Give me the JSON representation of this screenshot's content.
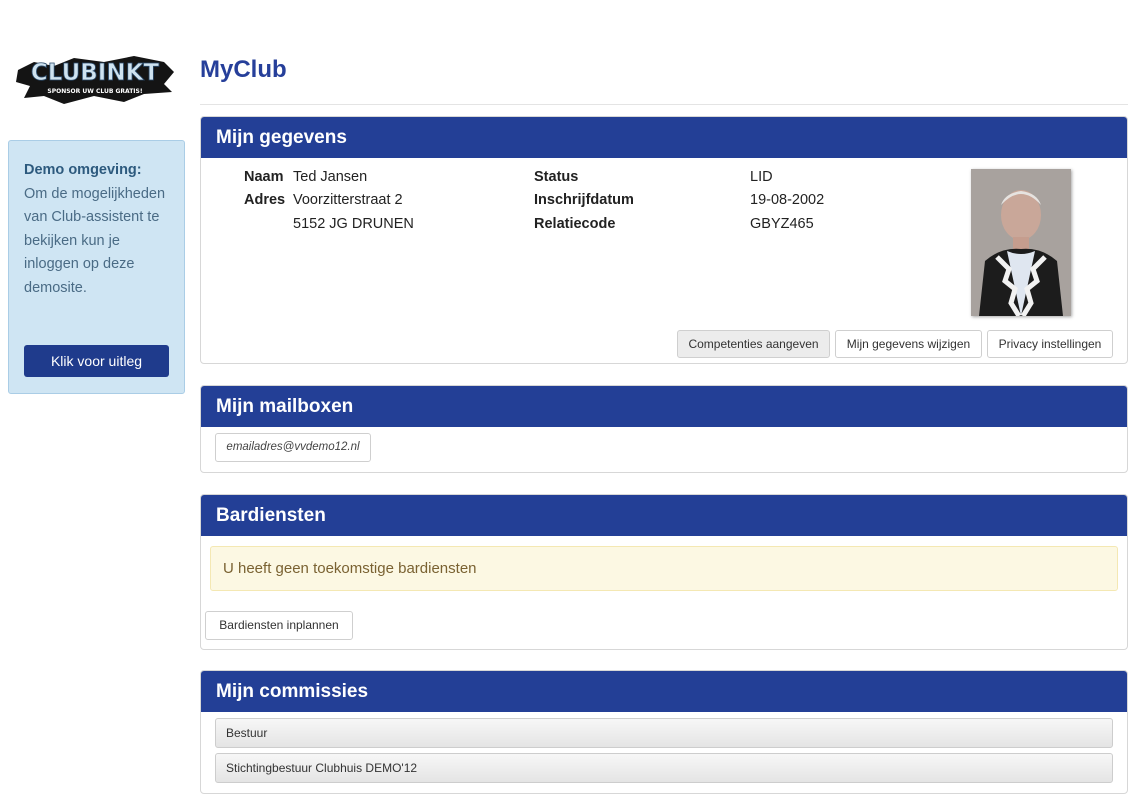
{
  "logo": {
    "text": "CLUBINKT",
    "tagline": "SPONSOR UW CLUB GRATIS!"
  },
  "demo": {
    "title": "Demo omgeving:",
    "text": "Om de mogelijkheden van Club-assistent te bekijken kun je inloggen op deze demosite.",
    "button": "Klik voor uitleg"
  },
  "page": {
    "title": "MyClub"
  },
  "gegevens": {
    "heading": "Mijn gegevens",
    "naam_label": "Naam",
    "naam": "Ted Jansen",
    "adres_label": "Adres",
    "adres1": "Voorzitterstraat 2",
    "adres2": "5152 JG DRUNEN",
    "status_label": "Status",
    "status": "LID",
    "inschrijf_label": "Inschrijfdatum",
    "inschrijf": "19-08-2002",
    "relatie_label": "Relatiecode",
    "relatie": "GBYZ465",
    "buttons": {
      "competenties": "Competenties aangeven",
      "wijzigen": "Mijn gegevens wijzigen",
      "privacy": "Privacy instellingen"
    }
  },
  "mailboxen": {
    "heading": "Mijn mailboxen",
    "email": "emailadres@vvdemo12.nl"
  },
  "bardiensten": {
    "heading": "Bardiensten",
    "alert": "U heeft geen toekomstige bardiensten",
    "button": "Bardiensten inplannen"
  },
  "commissies": {
    "heading": "Mijn commissies",
    "items": [
      "Bestuur",
      "Stichtingbestuur Clubhuis DEMO'12"
    ]
  },
  "colors": {
    "header_blue": "#233f96",
    "title_blue": "#263f9a",
    "demo_bg": "#cfe5f3",
    "alert_bg": "#fcf8e3"
  }
}
